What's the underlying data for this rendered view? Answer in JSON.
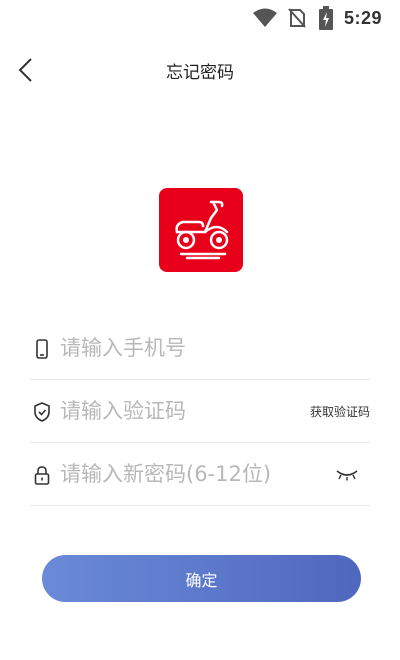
{
  "status_bar": {
    "time": "5:29"
  },
  "header": {
    "title": "忘记密码"
  },
  "form": {
    "phone": {
      "placeholder": "请输入手机号"
    },
    "code": {
      "placeholder": "请输入验证码",
      "get_code_label": "获取验证码"
    },
    "password": {
      "placeholder": "请输入新密码(6-12位)"
    }
  },
  "submit_label": "确定",
  "colors": {
    "brand_red": "#e8001b",
    "button_start": "#6b8ad8",
    "button_end": "#4f68bf"
  },
  "icons": [
    "wifi-icon",
    "no-sim-icon",
    "battery-charging-icon",
    "back-arrow-icon",
    "scooter-logo",
    "phone-icon",
    "shield-check-icon",
    "lock-icon",
    "eye-closed-icon"
  ]
}
